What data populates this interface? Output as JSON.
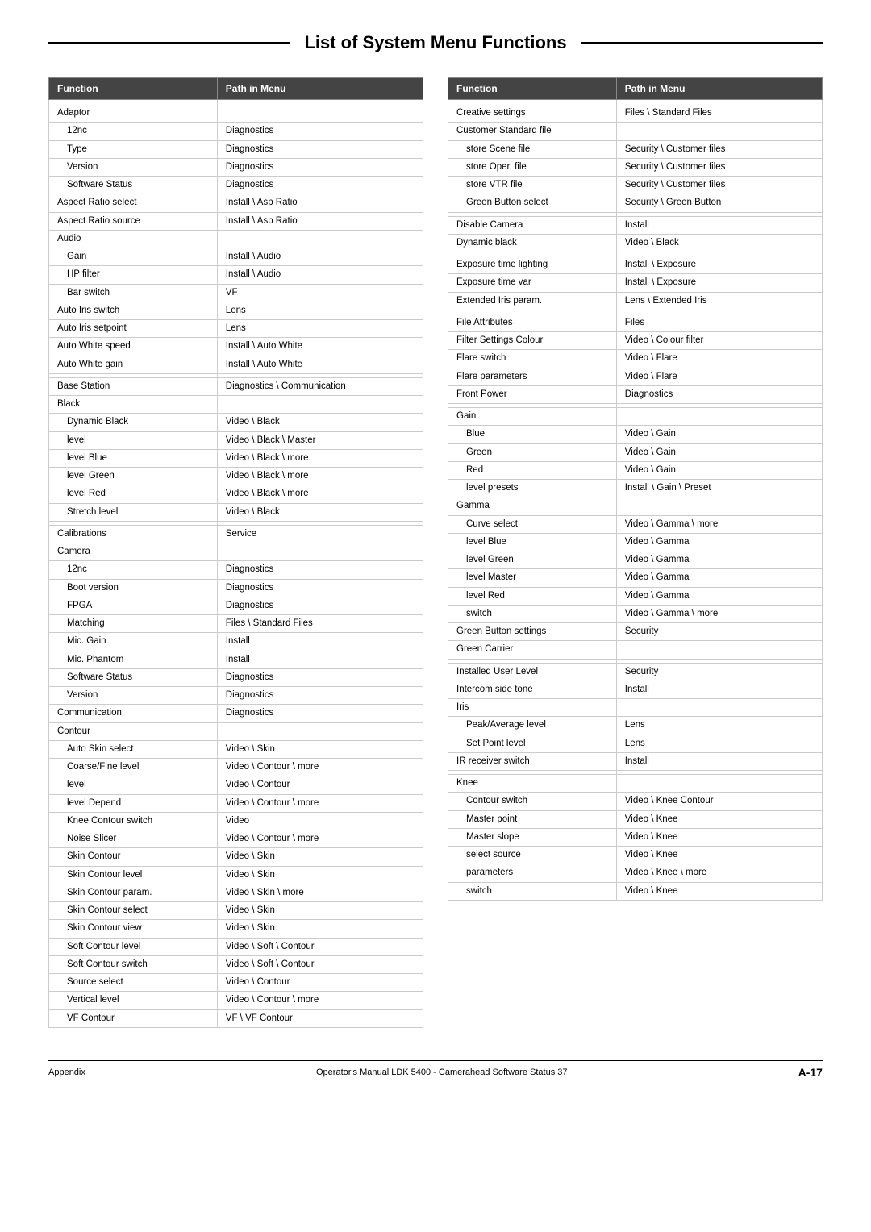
{
  "title": "List of System Menu Functions",
  "table_left": {
    "col1": "Function",
    "col2": "Path in Menu",
    "rows": [
      {
        "fn": "Adaptor",
        "path": "",
        "indent": 0
      },
      {
        "fn": "12nc",
        "path": "Diagnostics",
        "indent": 1
      },
      {
        "fn": "Type",
        "path": "Diagnostics",
        "indent": 1
      },
      {
        "fn": "Version",
        "path": "Diagnostics",
        "indent": 1
      },
      {
        "fn": "Software Status",
        "path": "Diagnostics",
        "indent": 1
      },
      {
        "fn": "Aspect Ratio select",
        "path": "Install \\ Asp Ratio",
        "indent": 0
      },
      {
        "fn": "Aspect Ratio source",
        "path": "Install \\ Asp Ratio",
        "indent": 0
      },
      {
        "fn": "Audio",
        "path": "",
        "indent": 0
      },
      {
        "fn": "Gain",
        "path": "Install \\ Audio",
        "indent": 1
      },
      {
        "fn": "HP filter",
        "path": "Install \\ Audio",
        "indent": 1
      },
      {
        "fn": "Bar switch",
        "path": "VF",
        "indent": 1
      },
      {
        "fn": "Auto Iris switch",
        "path": "Lens",
        "indent": 0
      },
      {
        "fn": "Auto Iris setpoint",
        "path": "Lens",
        "indent": 0
      },
      {
        "fn": "Auto White speed",
        "path": "Install \\ Auto White",
        "indent": 0
      },
      {
        "fn": "Auto White gain",
        "path": "Install \\ Auto White",
        "indent": 0
      },
      {
        "fn": "",
        "path": "",
        "indent": 0
      },
      {
        "fn": "Base Station",
        "path": "Diagnostics \\ Communication",
        "indent": 0
      },
      {
        "fn": "Black",
        "path": "",
        "indent": 0
      },
      {
        "fn": "Dynamic Black",
        "path": "Video \\ Black",
        "indent": 1
      },
      {
        "fn": "level",
        "path": "Video \\ Black \\ Master",
        "indent": 1
      },
      {
        "fn": "level Blue",
        "path": "Video \\ Black \\ more",
        "indent": 1
      },
      {
        "fn": "level Green",
        "path": "Video \\ Black \\ more",
        "indent": 1
      },
      {
        "fn": "level Red",
        "path": "Video \\ Black \\ more",
        "indent": 1
      },
      {
        "fn": "Stretch level",
        "path": "Video \\ Black",
        "indent": 1
      },
      {
        "fn": "",
        "path": "",
        "indent": 0
      },
      {
        "fn": "Calibrations",
        "path": "Service",
        "indent": 0
      },
      {
        "fn": "Camera",
        "path": "",
        "indent": 0
      },
      {
        "fn": "12nc",
        "path": "Diagnostics",
        "indent": 1
      },
      {
        "fn": "Boot version",
        "path": "Diagnostics",
        "indent": 1
      },
      {
        "fn": "FPGA",
        "path": "Diagnostics",
        "indent": 1
      },
      {
        "fn": "Matching",
        "path": "Files \\ Standard Files",
        "indent": 1
      },
      {
        "fn": "Mic. Gain",
        "path": "Install",
        "indent": 1
      },
      {
        "fn": "Mic. Phantom",
        "path": "Install",
        "indent": 1
      },
      {
        "fn": "Software Status",
        "path": "Diagnostics",
        "indent": 1
      },
      {
        "fn": "Version",
        "path": "Diagnostics",
        "indent": 1
      },
      {
        "fn": "Communication",
        "path": "Diagnostics",
        "indent": 0
      },
      {
        "fn": "Contour",
        "path": "",
        "indent": 0
      },
      {
        "fn": "Auto Skin select",
        "path": "Video \\ Skin",
        "indent": 1
      },
      {
        "fn": "Coarse/Fine level",
        "path": "Video \\ Contour \\ more",
        "indent": 1
      },
      {
        "fn": "level",
        "path": "Video \\ Contour",
        "indent": 1
      },
      {
        "fn": "level Depend",
        "path": "Video \\ Contour \\ more",
        "indent": 1
      },
      {
        "fn": "Knee Contour switch",
        "path": "Video",
        "indent": 1
      },
      {
        "fn": "Noise Slicer",
        "path": "Video \\ Contour \\ more",
        "indent": 1
      },
      {
        "fn": "Skin Contour",
        "path": "Video \\ Skin",
        "indent": 1
      },
      {
        "fn": "Skin Contour level",
        "path": "Video \\ Skin",
        "indent": 1
      },
      {
        "fn": "Skin Contour param.",
        "path": "Video \\ Skin \\ more",
        "indent": 1
      },
      {
        "fn": "Skin Contour select",
        "path": "Video \\ Skin",
        "indent": 1
      },
      {
        "fn": "Skin Contour view",
        "path": "Video \\ Skin",
        "indent": 1
      },
      {
        "fn": "Soft Contour level",
        "path": "Video \\ Soft \\ Contour",
        "indent": 1
      },
      {
        "fn": "Soft Contour switch",
        "path": "Video \\ Soft \\ Contour",
        "indent": 1
      },
      {
        "fn": "Source select",
        "path": "Video \\ Contour",
        "indent": 1
      },
      {
        "fn": "Vertical level",
        "path": "Video \\ Contour \\ more",
        "indent": 1
      },
      {
        "fn": "VF Contour",
        "path": "VF \\ VF Contour",
        "indent": 1
      }
    ]
  },
  "table_right": {
    "col1": "Function",
    "col2": "Path in Menu",
    "rows": [
      {
        "fn": "Creative settings",
        "path": "Files \\ Standard Files",
        "indent": 0
      },
      {
        "fn": "Customer Standard file",
        "path": "",
        "indent": 0
      },
      {
        "fn": "store Scene file",
        "path": "Security \\ Customer files",
        "indent": 1
      },
      {
        "fn": "store Oper. file",
        "path": "Security \\ Customer files",
        "indent": 1
      },
      {
        "fn": "store VTR file",
        "path": "Security \\ Customer files",
        "indent": 1
      },
      {
        "fn": "Green Button select",
        "path": "Security \\ Green Button",
        "indent": 1
      },
      {
        "fn": "",
        "path": "",
        "indent": 0
      },
      {
        "fn": "Disable Camera",
        "path": "Install",
        "indent": 0
      },
      {
        "fn": "Dynamic black",
        "path": "Video \\ Black",
        "indent": 0
      },
      {
        "fn": "",
        "path": "",
        "indent": 0
      },
      {
        "fn": "Exposure time lighting",
        "path": "Install \\ Exposure",
        "indent": 0
      },
      {
        "fn": "Exposure time var",
        "path": "Install \\ Exposure",
        "indent": 0
      },
      {
        "fn": "Extended Iris param.",
        "path": "Lens \\ Extended Iris",
        "indent": 0
      },
      {
        "fn": "",
        "path": "",
        "indent": 0
      },
      {
        "fn": "File Attributes",
        "path": "Files",
        "indent": 0
      },
      {
        "fn": "Filter Settings Colour",
        "path": "Video \\ Colour filter",
        "indent": 0
      },
      {
        "fn": "Flare switch",
        "path": "Video \\ Flare",
        "indent": 0
      },
      {
        "fn": "Flare parameters",
        "path": "Video \\ Flare",
        "indent": 0
      },
      {
        "fn": "Front Power",
        "path": "Diagnostics",
        "indent": 0
      },
      {
        "fn": "",
        "path": "",
        "indent": 0
      },
      {
        "fn": "Gain",
        "path": "",
        "indent": 0
      },
      {
        "fn": "Blue",
        "path": "Video \\ Gain",
        "indent": 1
      },
      {
        "fn": "Green",
        "path": "Video \\ Gain",
        "indent": 1
      },
      {
        "fn": "Red",
        "path": "Video \\ Gain",
        "indent": 1
      },
      {
        "fn": "level presets",
        "path": "Install \\ Gain \\ Preset",
        "indent": 1
      },
      {
        "fn": "Gamma",
        "path": "",
        "indent": 0
      },
      {
        "fn": "Curve select",
        "path": "Video \\ Gamma \\ more",
        "indent": 1
      },
      {
        "fn": "level Blue",
        "path": "Video \\ Gamma",
        "indent": 1
      },
      {
        "fn": "level Green",
        "path": "Video \\ Gamma",
        "indent": 1
      },
      {
        "fn": "level Master",
        "path": "Video \\ Gamma",
        "indent": 1
      },
      {
        "fn": "level Red",
        "path": "Video \\ Gamma",
        "indent": 1
      },
      {
        "fn": "switch",
        "path": "Video \\ Gamma \\ more",
        "indent": 1
      },
      {
        "fn": "Green Button settings",
        "path": "Security",
        "indent": 0
      },
      {
        "fn": "Green Carrier",
        "path": "",
        "indent": 0
      },
      {
        "fn": "",
        "path": "",
        "indent": 0
      },
      {
        "fn": "Installed User Level",
        "path": "Security",
        "indent": 0
      },
      {
        "fn": "Intercom side tone",
        "path": "Install",
        "indent": 0
      },
      {
        "fn": "Iris",
        "path": "",
        "indent": 0
      },
      {
        "fn": "Peak/Average level",
        "path": "Lens",
        "indent": 1
      },
      {
        "fn": "Set Point level",
        "path": "Lens",
        "indent": 1
      },
      {
        "fn": "IR receiver switch",
        "path": "Install",
        "indent": 0
      },
      {
        "fn": "",
        "path": "",
        "indent": 0
      },
      {
        "fn": "Knee",
        "path": "",
        "indent": 0
      },
      {
        "fn": "Contour switch",
        "path": "Video \\ Knee Contour",
        "indent": 1
      },
      {
        "fn": "Master point",
        "path": "Video \\ Knee",
        "indent": 1
      },
      {
        "fn": "Master slope",
        "path": "Video \\ Knee",
        "indent": 1
      },
      {
        "fn": "select source",
        "path": "Video \\ Knee",
        "indent": 1
      },
      {
        "fn": "parameters",
        "path": "Video \\ Knee \\ more",
        "indent": 1
      },
      {
        "fn": "switch",
        "path": "Video \\ Knee",
        "indent": 1
      }
    ]
  },
  "footer": {
    "left": "Appendix",
    "center": "Operator's Manual LDK 5400 - Camerahead Software Status 37",
    "right": "A-17"
  }
}
